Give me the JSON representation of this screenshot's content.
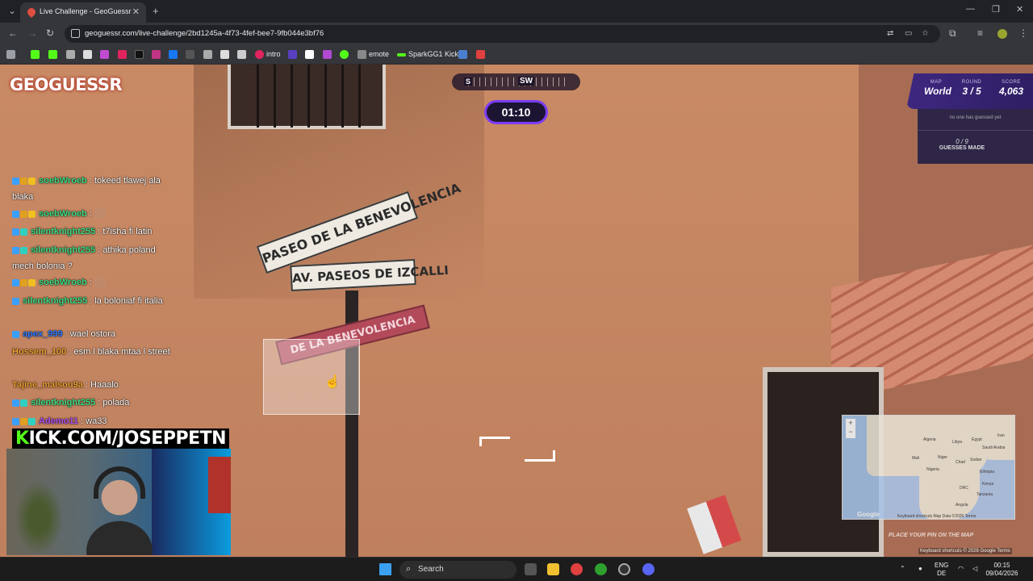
{
  "browser": {
    "tab_title": "Live Challenge - GeoGuessr",
    "url": "geoguessr.com/live-challenge/2bd1245a-4f73-4fef-bee7-9fb044e3bf76",
    "bookmarks": [
      {
        "label": "intro",
        "color": "#e0245e"
      },
      {
        "label": "emote",
        "color": "#888888"
      },
      {
        "label": "SparkGG1 Kick",
        "color": "#53fc18"
      }
    ]
  },
  "game": {
    "logo": "GEOGUESSR",
    "compass": {
      "s": "S",
      "sw": "SW"
    },
    "timer": "01:10",
    "status": {
      "map_label": "MAP",
      "map_value": "World",
      "round_label": "ROUND",
      "round_value": "3 / 5",
      "score_label": "SCORE",
      "score_value": "4,063"
    },
    "guess_info": {
      "none_text": "no one has guessed yet",
      "count": "0 / 9",
      "label": "GUESSES MADE"
    },
    "minimap": {
      "zoom_plus": "+",
      "zoom_minus": "−",
      "google": "Google",
      "credits": "Keyboard shortcuts   Map Data ©2026   Terms",
      "place_pin": "PLACE YOUR PIN ON THE MAP",
      "footer": "Keyboard shortcuts  © 2026 Google   Terms",
      "labels": [
        "Algeria",
        "Libya",
        "Egypt",
        "Saudi Arabia",
        "Mali",
        "Niger",
        "Chad",
        "Sudan",
        "Nigeria",
        "Ethiopia",
        "Kenya",
        "DRC",
        "Tanzania",
        "Angola",
        "Iran"
      ]
    },
    "street_signs": [
      "PASEO DE LA BENEVOLENCIA",
      "AV. PASEOS DE IZCALLI",
      "DE LA BENEVOLENCIA"
    ]
  },
  "chat": [
    {
      "user": "soebWroeb",
      "color": "#3ddc84",
      "text": ": tokeed tlawej ala blaka"
    },
    {
      "user": "soebWroeb",
      "color": "#3ddc84",
      "text": ":",
      "emote": true
    },
    {
      "user": "silentknight255",
      "color": "#3ddc84",
      "text": ": t7isha fi latin"
    },
    {
      "user": "silentknight255",
      "color": "#3ddc84",
      "text": ": athika poland mech bolonia ?"
    },
    {
      "user": "soebWroeb",
      "color": "#3ddc84",
      "text": ":",
      "emote": true
    },
    {
      "user": "silentknight255",
      "color": "#3ddc84",
      "text": ": la boloniaf fi italia"
    },
    {
      "user": "apex_999",
      "color": "#2f7bff",
      "text": ": wael ostora"
    },
    {
      "user": "Hossem_100",
      "color": "#f0a030",
      "text": ": esm l blaka mtaa l street"
    },
    {
      "user": "Tajine_malsou9a",
      "color": "#f0a030",
      "text": ": Haaalo"
    },
    {
      "user": "silentknight255",
      "color": "#3ddc84",
      "text": ": polada"
    },
    {
      "user": "Ademo11",
      "color": "#b050f0",
      "text": ": wa33"
    }
  ],
  "stream": {
    "kick_k": "K",
    "kick_rest": "ICK.COM/JOSEPPETN"
  },
  "taskbar": {
    "search": "Search",
    "lang_top": "ENG",
    "lang_bottom": "DE",
    "time": "00:15",
    "date": "09/04/2026"
  }
}
